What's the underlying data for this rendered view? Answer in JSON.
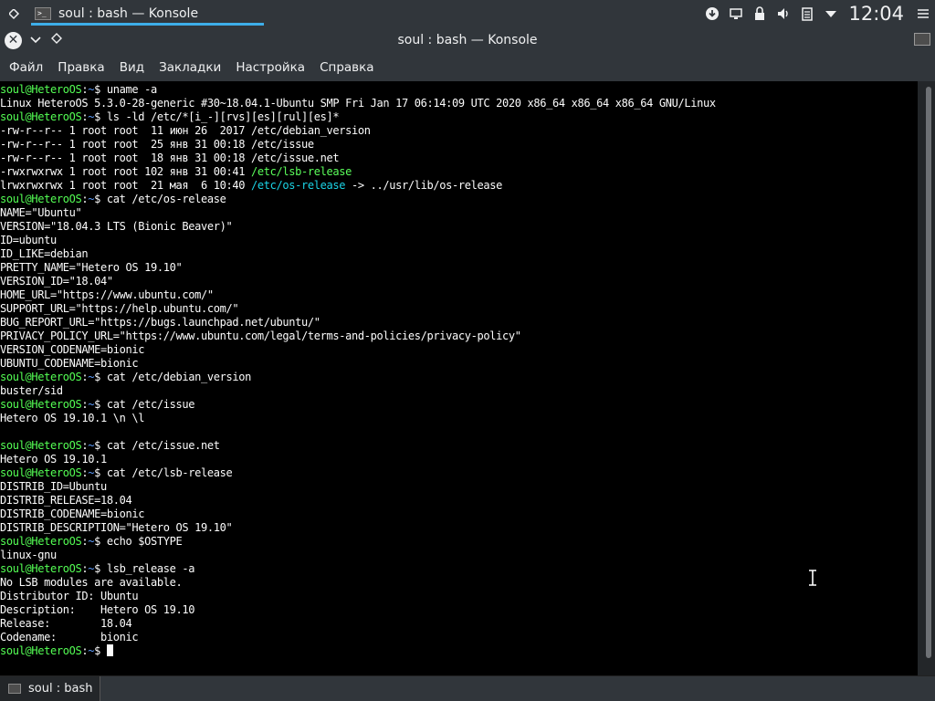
{
  "panel": {
    "task_title": "soul : bash — Konsole",
    "clock": "12:04"
  },
  "window": {
    "title": "soul : bash — Konsole"
  },
  "menu": [
    "Файл",
    "Правка",
    "Вид",
    "Закладки",
    "Настройка",
    "Справка"
  ],
  "terminal": {
    "prompt_user": "soul@HeteroOS",
    "prompt_path": "~",
    "lines": [
      {
        "type": "cmd",
        "text": "uname -a"
      },
      {
        "type": "out",
        "text": "Linux HeteroOS 5.3.0-28-generic #30~18.04.1-Ubuntu SMP Fri Jan 17 06:14:09 UTC 2020 x86_64 x86_64 x86_64 GNU/Linux"
      },
      {
        "type": "cmd",
        "text": "ls -ld /etc/*[i_-][rvs][es][rul][es]*"
      },
      {
        "type": "out",
        "text": "-rw-r--r-- 1 root root  11 июн 26  2017 /etc/debian_version"
      },
      {
        "type": "out",
        "text": "-rw-r--r-- 1 root root  25 янв 31 00:18 /etc/issue"
      },
      {
        "type": "out",
        "text": "-rw-r--r-- 1 root root  18 янв 31 00:18 /etc/issue.net"
      },
      {
        "type": "exec",
        "text": "-rwxrwxrwx 1 root root 102 янв 31 00:41 ",
        "hl": "/etc/lsb-release"
      },
      {
        "type": "link",
        "text": "lrwxrwxrwx 1 root root  21 мая  6 10:40 ",
        "hl": "/etc/os-release",
        "rest": " -> ../usr/lib/os-release"
      },
      {
        "type": "cmd",
        "text": "cat /etc/os-release"
      },
      {
        "type": "out",
        "text": "NAME=\"Ubuntu\""
      },
      {
        "type": "out",
        "text": "VERSION=\"18.04.3 LTS (Bionic Beaver)\""
      },
      {
        "type": "out",
        "text": "ID=ubuntu"
      },
      {
        "type": "out",
        "text": "ID_LIKE=debian"
      },
      {
        "type": "out",
        "text": "PRETTY_NAME=\"Hetero OS 19.10\""
      },
      {
        "type": "out",
        "text": "VERSION_ID=\"18.04\""
      },
      {
        "type": "out",
        "text": "HOME_URL=\"https://www.ubuntu.com/\""
      },
      {
        "type": "out",
        "text": "SUPPORT_URL=\"https://help.ubuntu.com/\""
      },
      {
        "type": "out",
        "text": "BUG_REPORT_URL=\"https://bugs.launchpad.net/ubuntu/\""
      },
      {
        "type": "out",
        "text": "PRIVACY_POLICY_URL=\"https://www.ubuntu.com/legal/terms-and-policies/privacy-policy\""
      },
      {
        "type": "out",
        "text": "VERSION_CODENAME=bionic"
      },
      {
        "type": "out",
        "text": "UBUNTU_CODENAME=bionic"
      },
      {
        "type": "cmd",
        "text": "cat /etc/debian_version"
      },
      {
        "type": "out",
        "text": "buster/sid"
      },
      {
        "type": "cmd",
        "text": "cat /etc/issue"
      },
      {
        "type": "out",
        "text": "Hetero OS 19.10.1 \\n \\l"
      },
      {
        "type": "out",
        "text": ""
      },
      {
        "type": "cmd",
        "text": "cat /etc/issue.net"
      },
      {
        "type": "out",
        "text": "Hetero OS 19.10.1"
      },
      {
        "type": "cmd",
        "text": "cat /etc/lsb-release"
      },
      {
        "type": "out",
        "text": "DISTRIB_ID=Ubuntu"
      },
      {
        "type": "out",
        "text": "DISTRIB_RELEASE=18.04"
      },
      {
        "type": "out",
        "text": "DISTRIB_CODENAME=bionic"
      },
      {
        "type": "out",
        "text": "DISTRIB_DESCRIPTION=\"Hetero OS 19.10\""
      },
      {
        "type": "cmd",
        "text": "echo $OSTYPE"
      },
      {
        "type": "out",
        "text": "linux-gnu"
      },
      {
        "type": "cmd",
        "text": "lsb_release -a"
      },
      {
        "type": "out",
        "text": "No LSB modules are available."
      },
      {
        "type": "out",
        "text": "Distributor ID:\tUbuntu"
      },
      {
        "type": "out",
        "text": "Description:\tHetero OS 19.10"
      },
      {
        "type": "out",
        "text": "Release:\t18.04"
      },
      {
        "type": "out",
        "text": "Codename:\tbionic"
      },
      {
        "type": "prompt",
        "text": ""
      }
    ]
  },
  "tab": {
    "label": "soul : bash"
  },
  "colors": {
    "panel_bg": "#31363b",
    "accent": "#3daee9",
    "prompt_user": "#54ff54",
    "prompt_path": "#5c9cff",
    "symlink": "#1bd4e6",
    "executable": "#5bff5b"
  }
}
